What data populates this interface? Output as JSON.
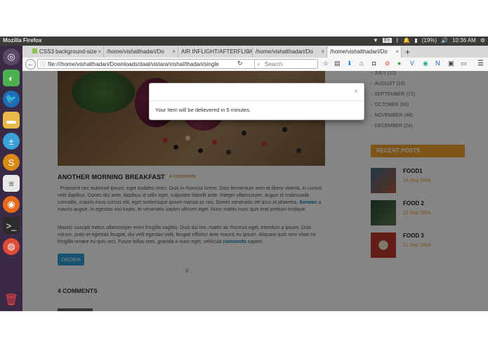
{
  "system": {
    "app_title": "Mozilla Firefox",
    "lang": "En",
    "battery": "(19%)",
    "time": "10:36 AM"
  },
  "tabs": [
    {
      "label": "CSS3 background-size"
    },
    {
      "label": "/home/vishalthadari/Do"
    },
    {
      "label": "AIR INFLIGHT/AFTERFLIGH"
    },
    {
      "label": "/home/vishalthadari/Do"
    },
    {
      "label": "/home/vishalthadari/Do"
    }
  ],
  "nav": {
    "url": "file:///home/vishalthadari/Downloads/daal/vistara/vishal/thadari/single",
    "search_placeholder": "Search"
  },
  "post": {
    "title": "ANOTHER MORNING BREAKFAST",
    "separator": "|",
    "comments": "4 comments",
    "para1_pre": ". Praesent nec euismod ipsum, eget sodales enim. Duis in rhoncus lorem. Duis fermentum sem et libero viverra, in cursus velit dapibus. Donec dui ante, dapibus ut odio eget, vulputate blandit ante. Integer ullamcorper, augue id malesuada convallis, mauris risus cursus elit, eget scelerisque ipsum massa ac nisi. Donec venenatis vel arcu at pharetra.",
    "para1_link": "Aenean",
    "para1_post": "a mauris augue. In egestas nisi turpis, et venenatis sapien ultrices eget. Nunc mattis nunc quis erat pretium tristique.",
    "para2_pre": "Mauris suscipit metus ullamcorper enim fringilla sagittis. Duis dui leo, mattis ac rhoncus eget, interdum a ipsum. Duis rutrum, justo et egestas feugiat, dui velit egestas velit, feugiat efficitur ante mauris eu ipsum. Aliquam quis sem vitae mi fringilla ornare eu quis orci. Fusce tellus sem, gravida a nunc eget, vehicula",
    "para2_link": "commodo",
    "para2_post": "sapien.",
    "order_label": "ORDER",
    "comments_heading": "4 COMMENTS"
  },
  "sidebar": {
    "archives": [
      "JULY (12)",
      "AUGUST (18)",
      "SEPTEMBER (72)",
      "OCTOBER (63)",
      "NOVEMBER (48)",
      "DECEMBER (24)"
    ],
    "recent_heading": "RECENT POSTS",
    "recent": [
      {
        "name": "FOOD1",
        "date": "24 Sep 2084"
      },
      {
        "name": "FOOD 2",
        "date": "22 Sep 2084"
      },
      {
        "name": "FOOD 3",
        "date": "21 Sep 2084"
      }
    ]
  },
  "modal": {
    "close": "×",
    "message": "Your Item will be delievered in 5 minutes."
  },
  "colors": {
    "accent": "#f0a12f",
    "link": "#1a7fb5",
    "button": "#2a9fd6",
    "launcher": "#3a2a45"
  }
}
